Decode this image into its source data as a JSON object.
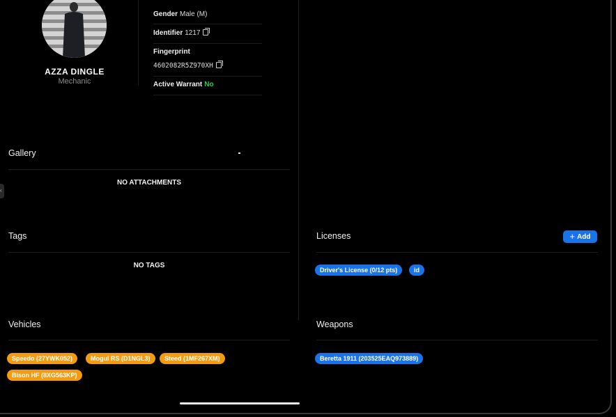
{
  "profile": {
    "name": "AZZA DINGLE",
    "job": "Mechanic",
    "gender_label": "Gender",
    "gender_value": "Male (M)",
    "identifier_label": "Identifier",
    "identifier_value": "1217",
    "fingerprint_label": "Fingerprint",
    "fingerprint_value": "4602082R5Z970XH",
    "warrant_label": "Active Warrant",
    "warrant_value": "No"
  },
  "gallery": {
    "title": "Gallery",
    "empty": "NO ATTACHMENTS"
  },
  "tags": {
    "title": "Tags",
    "empty": "NO TAGS"
  },
  "licenses": {
    "title": "Licenses",
    "add_label": "Add",
    "items": [
      "Driver's License (0/12 pts)",
      "id"
    ]
  },
  "vehicles": {
    "title": "Vehicles",
    "items": [
      "Speedo (27YWK052)",
      "Mogul RS (D1NGL3)",
      "Steed (1MF267XM)",
      "Bison HF (8XG563KP)"
    ]
  },
  "weapons": {
    "title": "Weapons",
    "items": [
      "Beretta 1911 (203525EAQ973889)"
    ]
  },
  "colors": {
    "vehicle_chip": "#f39c12",
    "license_chip": "#1a73e8",
    "warrant_no": "#2fcf4f"
  }
}
